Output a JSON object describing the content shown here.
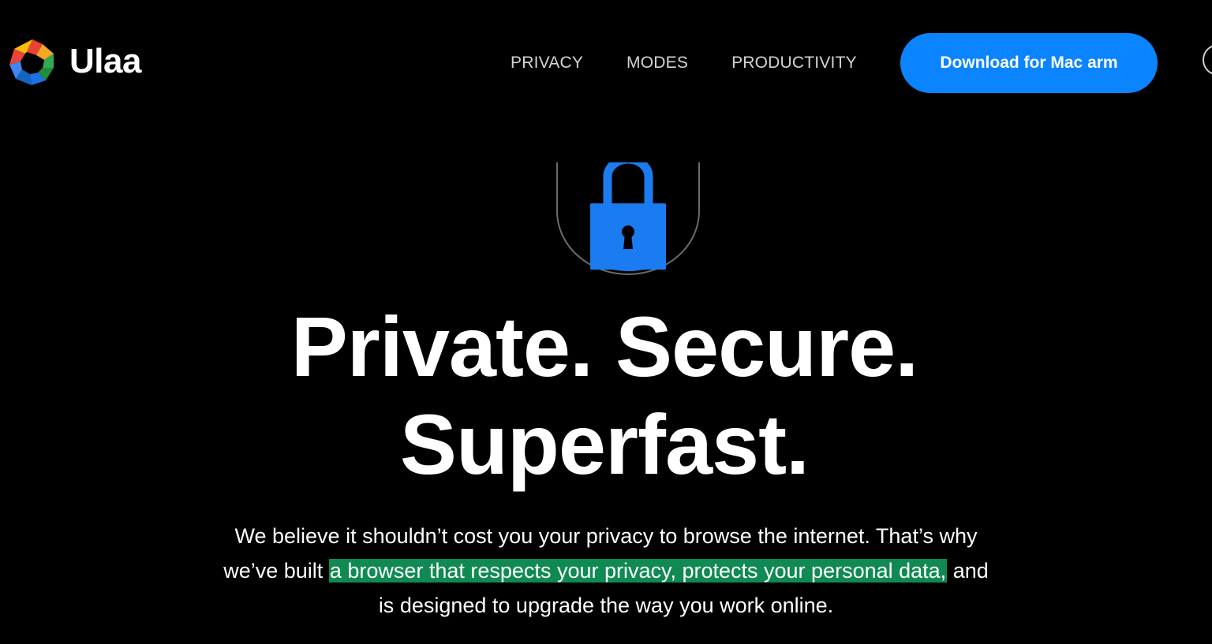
{
  "brand": {
    "name": "Ulaa",
    "logo_icon": "ulaa-logo-icon",
    "colors": [
      "#ea4335",
      "#fbbc05",
      "#34a853",
      "#1a73e8",
      "#e8443a"
    ]
  },
  "nav": {
    "items": [
      {
        "label": "PRIVACY"
      },
      {
        "label": "MODES"
      },
      {
        "label": "PRODUCTIVITY"
      }
    ]
  },
  "download": {
    "label": "Download for Mac arm",
    "color": "#0a84ff"
  },
  "hero": {
    "illustration_icon": "padlock-icon",
    "headline_line1": "Private. Secure.",
    "headline_line2": "Superfast.",
    "sub_line1": "We believe it shouldn’t cost you your privacy to browse the internet. That’s why",
    "sub_line2_pre": "we’ve built ",
    "sub_line2_highlight": "a browser that respects your privacy, protects your personal data,",
    "sub_line2_post": " and",
    "sub_line3": "is designed to upgrade the way you work online.",
    "highlight_color": "#0f8a52"
  }
}
